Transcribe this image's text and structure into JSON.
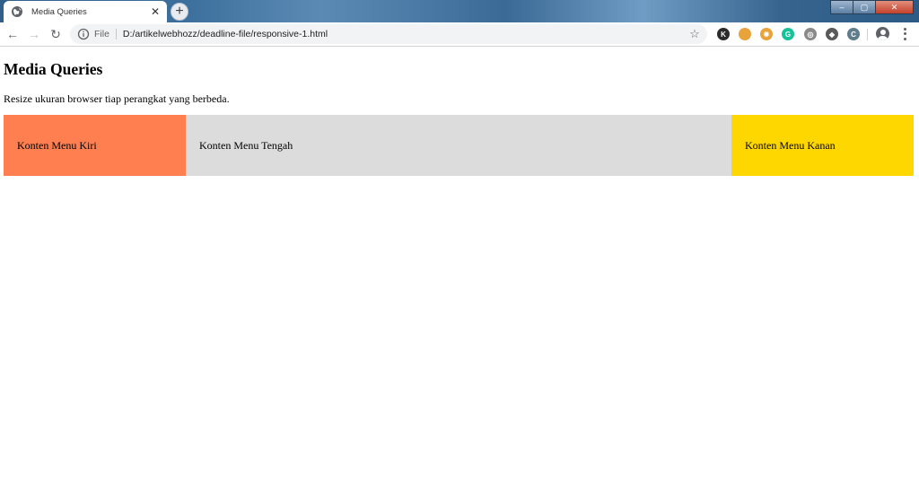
{
  "browser": {
    "tab": {
      "title": "Media Queries",
      "favicon": "globe-icon",
      "close_glyph": "✕"
    },
    "new_tab_glyph": "+",
    "window_controls": {
      "minimize": "–",
      "maximize": "▢",
      "close": "✕"
    },
    "nav": {
      "back_glyph": "←",
      "forward_glyph": "→",
      "reload_glyph": "↻"
    },
    "address_bar": {
      "scheme_label": "File",
      "url": "D:/artikelwebhozz/deadline-file/responsive-1.html",
      "info_icon": "info-icon",
      "bookmark_glyph": "☆"
    },
    "extensions": [
      {
        "name": "k-extension-icon",
        "glyph": "K",
        "color": "#2b2b2b"
      },
      {
        "name": "half-circle-extension-icon",
        "glyph": "",
        "color": "#e8a33b"
      },
      {
        "name": "sun-extension-icon",
        "glyph": "✹",
        "color": "#e8a33b"
      },
      {
        "name": "grammarly-extension-icon",
        "glyph": "G",
        "color": "#15c39a"
      },
      {
        "name": "globe-extension-icon",
        "glyph": "◎",
        "color": "#8a8a8a"
      },
      {
        "name": "diamond-extension-icon",
        "glyph": "◆",
        "color": "#5a5a5a"
      },
      {
        "name": "c-extension-icon",
        "glyph": "C",
        "color": "#607d8b"
      }
    ]
  },
  "page": {
    "heading": "Media Queries",
    "intro": "Resize ukuran browser tiap perangkat yang berbeda.",
    "columns": {
      "left": {
        "label": "Konten Menu Kiri",
        "color": "#ff7f50"
      },
      "middle": {
        "label": "Konten Menu Tengah",
        "color": "#dcdcdc"
      },
      "right": {
        "label": "Konten Menu Kanan",
        "color": "#ffd700"
      }
    }
  }
}
